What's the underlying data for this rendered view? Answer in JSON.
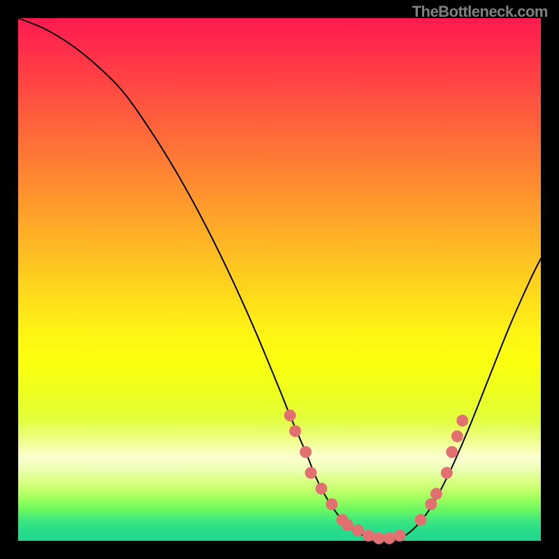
{
  "watermark": "TheBottleneck.com",
  "chart_data": {
    "type": "line",
    "title": "",
    "xlabel": "",
    "ylabel": "",
    "xlim": [
      0,
      100
    ],
    "ylim": [
      0,
      100
    ],
    "grid": false,
    "series": [
      {
        "name": "curve",
        "x": [
          0,
          5,
          10,
          15,
          20,
          25,
          30,
          35,
          40,
          45,
          50,
          52,
          55,
          58,
          62,
          66,
          70,
          74,
          78,
          82,
          86,
          90,
          94,
          98,
          100
        ],
        "y": [
          100,
          98,
          95,
          91,
          86,
          79,
          71,
          62,
          52,
          41,
          29,
          24,
          17,
          10,
          4,
          1,
          0,
          1,
          5,
          12,
          21,
          31,
          41,
          50,
          54
        ]
      }
    ],
    "markers": [
      {
        "x": 52,
        "y": 24
      },
      {
        "x": 53,
        "y": 21
      },
      {
        "x": 55,
        "y": 17
      },
      {
        "x": 56,
        "y": 13
      },
      {
        "x": 58,
        "y": 10
      },
      {
        "x": 60,
        "y": 7
      },
      {
        "x": 62,
        "y": 4
      },
      {
        "x": 63,
        "y": 3
      },
      {
        "x": 65,
        "y": 2
      },
      {
        "x": 67,
        "y": 1
      },
      {
        "x": 69,
        "y": 0.5
      },
      {
        "x": 71,
        "y": 0.5
      },
      {
        "x": 73,
        "y": 1
      },
      {
        "x": 77,
        "y": 4
      },
      {
        "x": 79,
        "y": 7
      },
      {
        "x": 80,
        "y": 9
      },
      {
        "x": 82,
        "y": 13
      },
      {
        "x": 83,
        "y": 17
      },
      {
        "x": 84,
        "y": 20
      },
      {
        "x": 85,
        "y": 23
      }
    ],
    "marker_color": "#e27070",
    "curve_color": "#000000"
  }
}
